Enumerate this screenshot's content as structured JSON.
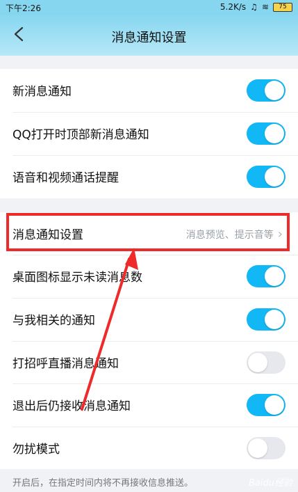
{
  "status_bar": {
    "time": "下午2:26",
    "network_speed": "5.2K/s",
    "battery": "75",
    "icons": [
      "app-notification-icon",
      "headphones-icon",
      "hd-icon",
      "4g-signal-icon",
      "wifi-icon",
      "battery-icon"
    ]
  },
  "header": {
    "title": "消息通知设置",
    "back_icon": "chevron-left-icon"
  },
  "section1": {
    "items": [
      {
        "label": "新消息通知",
        "toggle": true
      },
      {
        "label": "QQ打开时顶部新消息通知",
        "toggle": true
      },
      {
        "label": "语音和视频通话提醒",
        "toggle": true
      }
    ]
  },
  "section2": {
    "settings_row": {
      "label": "消息通知设置",
      "value": "消息预览、提示音等"
    },
    "items": [
      {
        "label": "桌面图标显示未读消息数",
        "toggle": true
      },
      {
        "label": "与我相关的通知",
        "toggle": true
      },
      {
        "label": "打招呼直播消息通知",
        "toggle": false
      },
      {
        "label": "退出后仍接收消息通知",
        "toggle": true
      },
      {
        "label": "勿扰模式",
        "toggle": false
      }
    ]
  },
  "footer_note": "开启后，在指定时间内将不再接收信息推送。",
  "colors": {
    "toggle_on": "#12b7f5",
    "toggle_off": "#e6e8ed",
    "highlight": "#ee2a2a",
    "header": "#86d6f0"
  },
  "watermark": "Baidu经验"
}
